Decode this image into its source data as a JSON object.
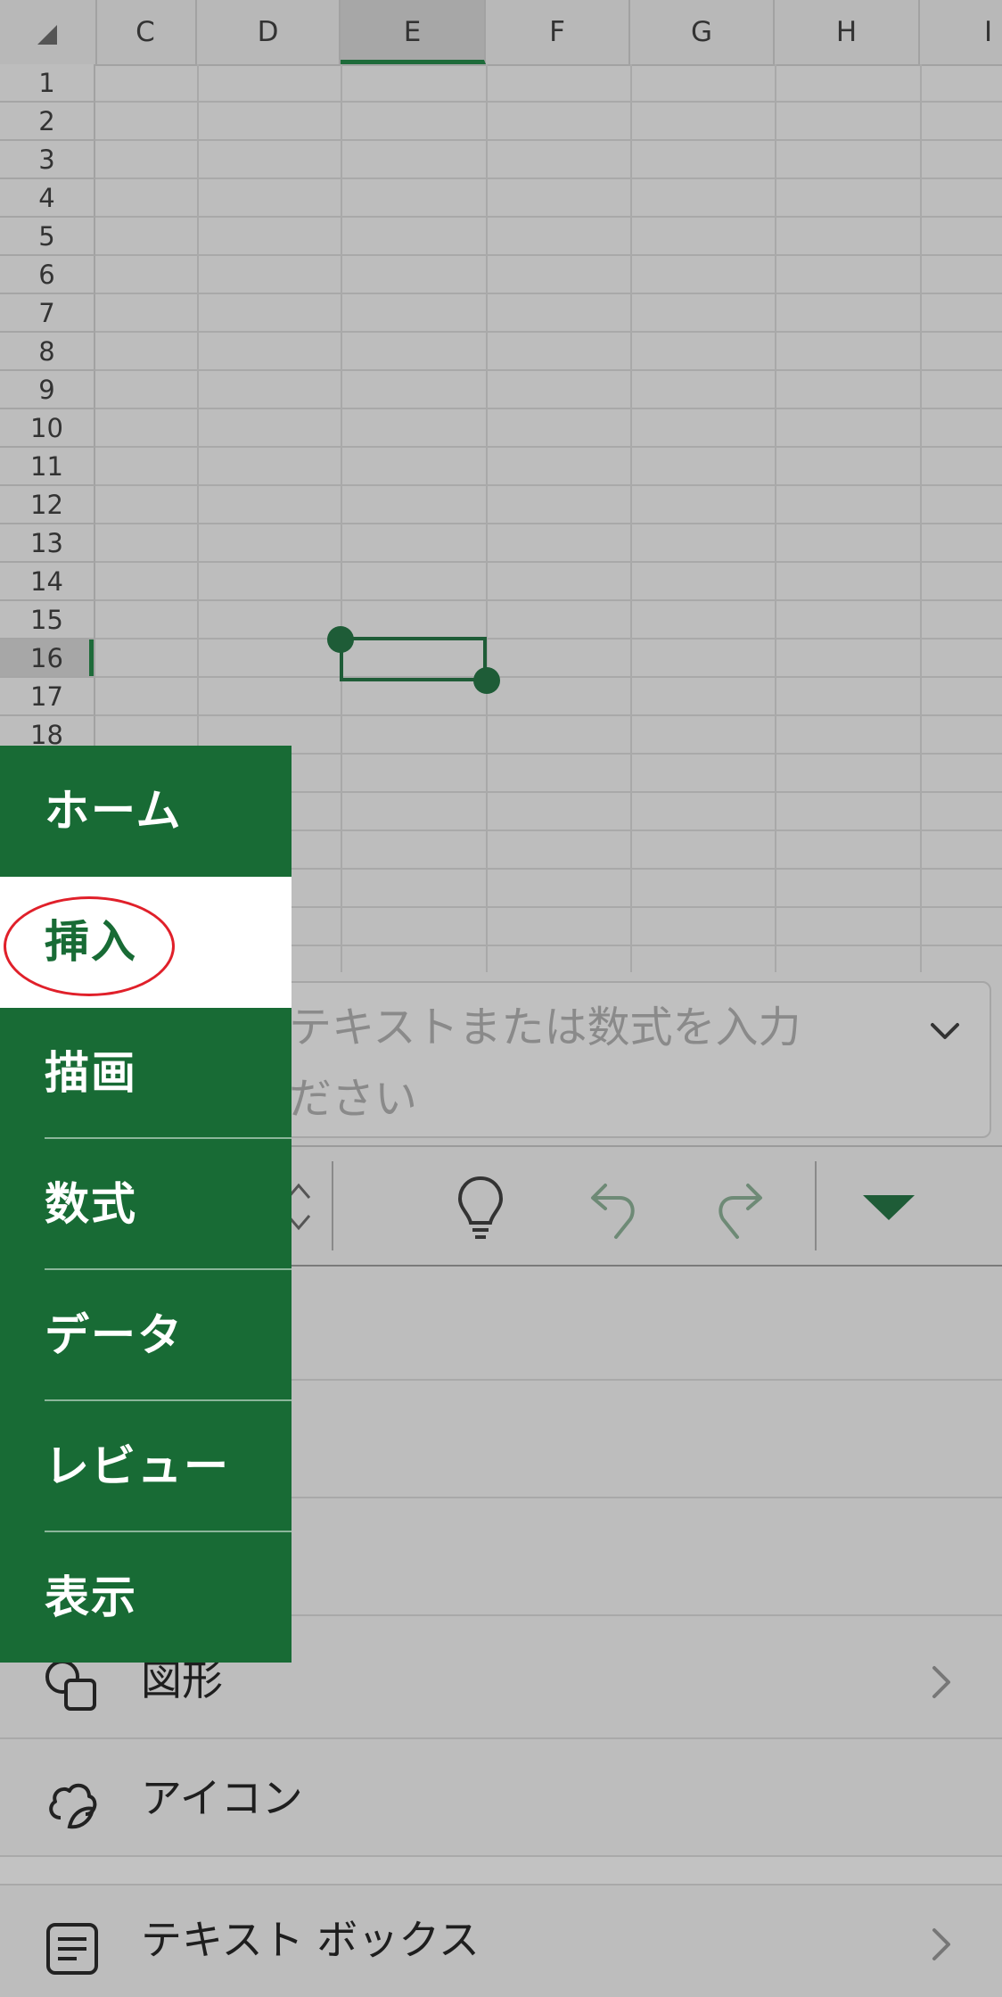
{
  "sheet": {
    "columns": [
      "C",
      "D",
      "E",
      "F",
      "G",
      "H",
      "I"
    ],
    "selected_column": "E",
    "rows": [
      "1",
      "2",
      "3",
      "4",
      "5",
      "6",
      "7",
      "8",
      "9",
      "10",
      "11",
      "12",
      "13",
      "14",
      "15",
      "16",
      "17",
      "18"
    ],
    "selected_row": "16"
  },
  "formula_bar": {
    "placeholder_line1": "テキストまたは数式を入力",
    "placeholder_line2": "ださい"
  },
  "toolbar": {
    "icons": [
      "updown-arrows-icon",
      "lightbulb-icon",
      "undo-icon",
      "redo-icon",
      "collapse-triangle-icon"
    ]
  },
  "tabs": [
    {
      "label": "ホーム",
      "active": false
    },
    {
      "label": "挿入",
      "active": true
    },
    {
      "label": "描画",
      "active": false
    },
    {
      "label": "数式",
      "active": false
    },
    {
      "label": "データ",
      "active": false
    },
    {
      "label": "レビュー",
      "active": false
    },
    {
      "label": "表示",
      "active": false
    }
  ],
  "insert_list": [
    {
      "label": "図形",
      "icon": "shapes-icon",
      "has_chevron": true
    },
    {
      "label": "アイコン",
      "icon": "icons-icon",
      "has_chevron": false
    },
    {
      "label": "テキスト ボックス",
      "icon": "textbox-icon",
      "has_chevron": true
    }
  ],
  "colors": {
    "excel_green": "#186b35",
    "annotation_red": "#e0202a"
  }
}
